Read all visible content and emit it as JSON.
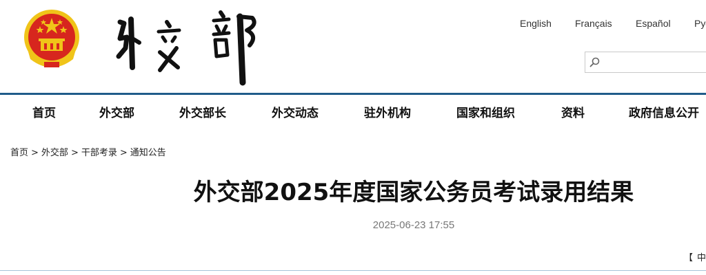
{
  "header": {
    "emblem_icon": "national-emblem-icon",
    "calligraphy_title": "外交部",
    "languages": [
      "English",
      "Français",
      "Español",
      "Русский"
    ],
    "search": {
      "value": "",
      "placeholder": "",
      "icon": "search-icon"
    }
  },
  "nav": {
    "items": [
      "首页",
      "外交部",
      "外交部长",
      "外交动态",
      "驻外机构",
      "国家和组织",
      "资料",
      "政府信息公开"
    ],
    "accent_color": "#1f5b8a"
  },
  "breadcrumb": {
    "items": [
      "首页",
      "外交部",
      "干部考录",
      "通知公告"
    ],
    "separator": ">"
  },
  "article": {
    "title": "外交部2025年度国家公务员考试录用结果",
    "date": "2025-06-23 17:55",
    "font_size_controls": [
      "【",
      "中"
    ]
  },
  "colors": {
    "emblem_red": "#d7261e",
    "emblem_gold": "#f0c419",
    "date_gray": "#777777"
  }
}
